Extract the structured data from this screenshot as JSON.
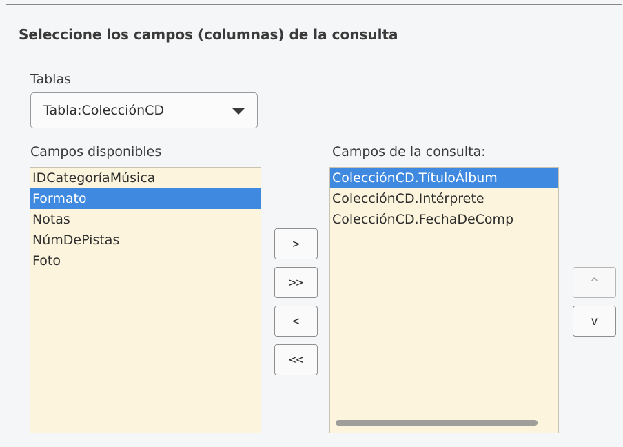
{
  "page": {
    "title": "Seleccione los campos (columnas) de la consulta"
  },
  "tables": {
    "label": "Tablas",
    "selected": "Tabla:ColecciónCD"
  },
  "available": {
    "label": "Campos disponibles",
    "items": [
      "IDCategoríaMúsica",
      "Formato",
      "Notas",
      "NúmDePistas",
      "Foto"
    ],
    "selected_index": 1
  },
  "query": {
    "label": "Campos de la consulta:",
    "items": [
      "ColecciónCD.TítuloÁlbum",
      "ColecciónCD.Intérprete",
      "ColecciónCD.FechaDeComp"
    ],
    "selected_index": 0
  },
  "buttons": {
    "add": ">",
    "add_all": ">>",
    "remove": "<",
    "remove_all": "<<",
    "move_up": "^",
    "move_down": "v"
  }
}
